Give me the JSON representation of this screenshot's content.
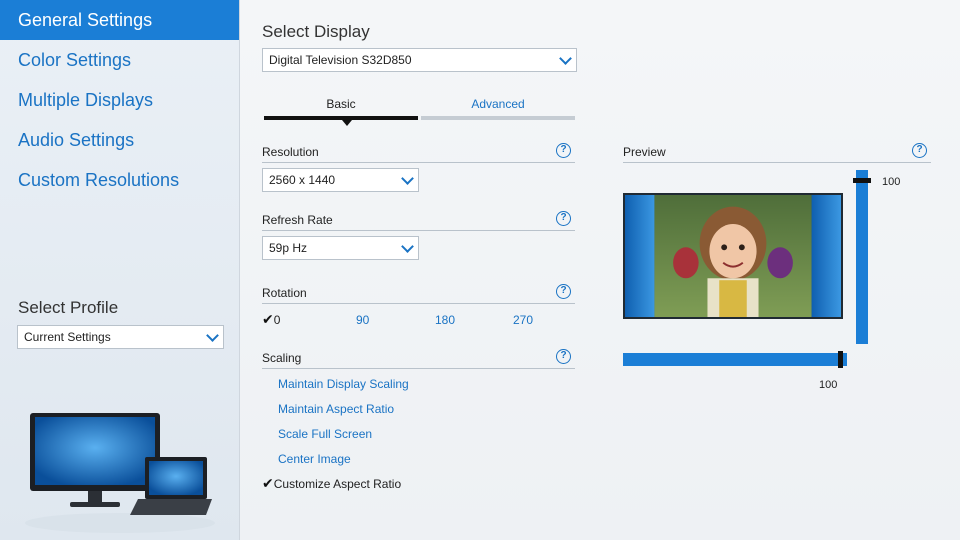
{
  "sidebar": {
    "items": [
      {
        "label": "General Settings"
      },
      {
        "label": "Color Settings"
      },
      {
        "label": "Multiple Displays"
      },
      {
        "label": "Audio Settings"
      },
      {
        "label": "Custom Resolutions"
      }
    ],
    "profile_title": "Select Profile",
    "profile_value": "Current Settings"
  },
  "main": {
    "select_display_title": "Select Display",
    "display_value": "Digital Television S32D850",
    "tabs": [
      {
        "label": "Basic"
      },
      {
        "label": "Advanced"
      }
    ],
    "resolution": {
      "label": "Resolution",
      "value": "2560 x 1440"
    },
    "refresh": {
      "label": "Refresh Rate",
      "value": "59p Hz"
    },
    "rotation": {
      "label": "Rotation",
      "options": [
        "0",
        "90",
        "180",
        "270"
      ],
      "selected": "0"
    },
    "scaling": {
      "label": "Scaling",
      "options": [
        "Maintain Display Scaling",
        "Maintain Aspect Ratio",
        "Scale Full Screen",
        "Center Image",
        "Customize Aspect Ratio"
      ],
      "selected": "Customize Aspect Ratio"
    },
    "help_glyph": "?"
  },
  "preview": {
    "label": "Preview",
    "vertical_value": "100",
    "horizontal_value": "100",
    "vertical_level": 1.0,
    "horizontal_level": 1.0
  },
  "colors": {
    "accent": "#1b7ed6",
    "link": "#1a73c4"
  },
  "check_glyph": "✔"
}
